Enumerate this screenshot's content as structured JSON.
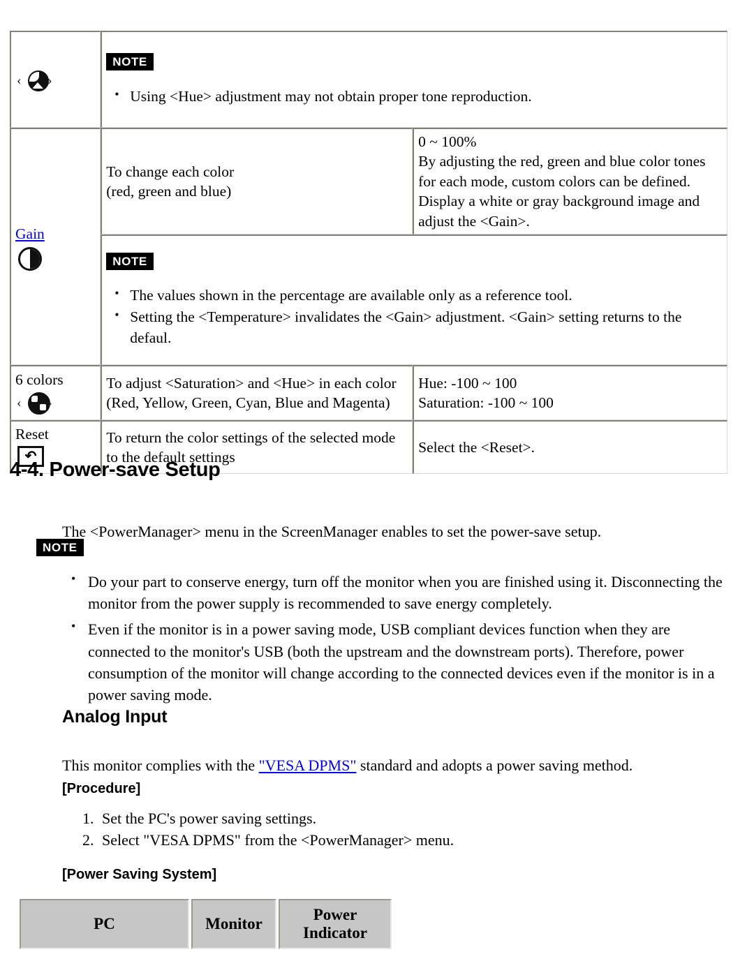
{
  "spec_table": {
    "rows": [
      {
        "type": "note",
        "icon": "hue-color-circle-icon",
        "badge": "NOTE",
        "bullets": [
          "Using <Hue> adjustment may not obtain proper tone reproduction."
        ]
      },
      {
        "type": "spec",
        "label": "",
        "link_label": "Gain",
        "icon": "contrast-circle-icon",
        "description": "To change each color\n(red, green and blue)",
        "description_line1": "To change each color",
        "description_line2": "(red, green and blue)",
        "range_lines": [
          "0 ~ 100%",
          "By adjusting the red, green and blue color tones",
          "for each mode, custom colors can be defined.",
          "Display a white or gray background image and",
          "adjust the <Gain>."
        ]
      },
      {
        "type": "note",
        "badge": "NOTE",
        "bullets": [
          "The values shown in the percentage are available only as a reference tool.",
          "Setting the <Temperature> invalidates the <Gain> adjustment. <Gain> setting returns to the defaul."
        ]
      },
      {
        "type": "spec",
        "label": "6 colors",
        "icon": "six-colors-icon",
        "description_line1": "To adjust <Saturation> and <Hue> in each color",
        "description_line2": "(Red, Yellow, Green, Cyan, Blue and Magenta)",
        "range_lines": [
          "Hue: -100 ~ 100",
          "Saturation: -100 ~ 100"
        ]
      },
      {
        "type": "spec",
        "label": "Reset",
        "icon": "reset-loop-icon",
        "description_line1": "To return the color settings of the selected mode",
        "description_line2": "to the default settings",
        "range_lines": [
          "Select the <Reset>."
        ]
      }
    ]
  },
  "section": {
    "title": "4-4. Power-save Setup",
    "intro": "The <PowerManager> menu in the ScreenManager enables to set the power-save setup.",
    "note_badge": "NOTE",
    "note_bullets": [
      "Do your part to conserve energy, turn off the monitor when you are finished using it. Disconnecting the monitor from the power supply is recommended to save energy completely.",
      "Even if the monitor is in a power saving mode, USB compliant devices function when they are connected to the monitor's USB (both the upstream and the downstream ports). Therefore, power consumption of the monitor will change according to the connected devices even if the monitor is in a power saving mode."
    ]
  },
  "analog": {
    "title": "Analog Input",
    "intro_before": "This monitor complies with the ",
    "link_text": "\"VESA DPMS\"",
    "intro_after": " standard and adopts a power saving method.",
    "procedure_label": "[Procedure]",
    "procedure_steps": [
      "Set the PC's power saving settings.",
      "Select \"VESA DPMS\" from the <PowerManager> menu."
    ],
    "power_saving_label": "[Power Saving System]"
  },
  "power_saving_table": {
    "headers": [
      "PC",
      "Monitor",
      "Power Indicator"
    ]
  },
  "colors": {
    "link": "#0000ee",
    "note_badge_bg": "#000000",
    "note_badge_fg": "#ffffff",
    "table_border": "#808078",
    "pss_header_bg": "#c6c6c6"
  }
}
